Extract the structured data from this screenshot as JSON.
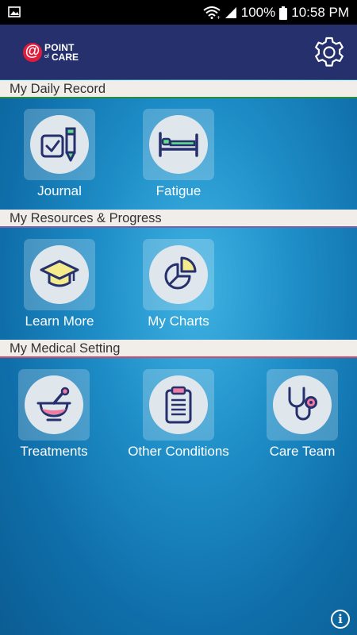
{
  "status_bar": {
    "battery": "100%",
    "time": "10:58 PM",
    "icons": [
      "gallery-icon",
      "wifi-icon",
      "signal-icon",
      "battery-icon"
    ]
  },
  "header": {
    "logo": {
      "at": "@",
      "point": "POINT",
      "of": "of",
      "care": "CARE"
    },
    "settings_icon": "gear-icon"
  },
  "sections": [
    {
      "title": "My Daily Record",
      "accent": "#2a8c3e"
    },
    {
      "title": "My Resources & Progress",
      "accent": "#7b62a8"
    },
    {
      "title": "My Medical Setting",
      "accent": "#d24a6a"
    }
  ],
  "tiles": {
    "journal": {
      "label": "Journal",
      "icon": "journal-icon"
    },
    "fatigue": {
      "label": "Fatigue",
      "icon": "bed-icon"
    },
    "learn_more": {
      "label": "Learn More",
      "icon": "graduation-cap-icon"
    },
    "my_charts": {
      "label": "My Charts",
      "icon": "pie-chart-icon"
    },
    "treatments": {
      "label": "Treatments",
      "icon": "mortar-pestle-icon"
    },
    "other_conditions": {
      "label": "Other Conditions",
      "icon": "clipboard-icon"
    },
    "care_team": {
      "label": "Care Team",
      "icon": "stethoscope-icon"
    }
  },
  "info_button": {
    "glyph": "i",
    "icon": "info-icon"
  },
  "colors": {
    "header_bg": "#26306c",
    "icon_navy": "#26306c",
    "green": "#5ee08a",
    "yellow": "#f3eb8c",
    "pink": "#ef7aa2"
  }
}
